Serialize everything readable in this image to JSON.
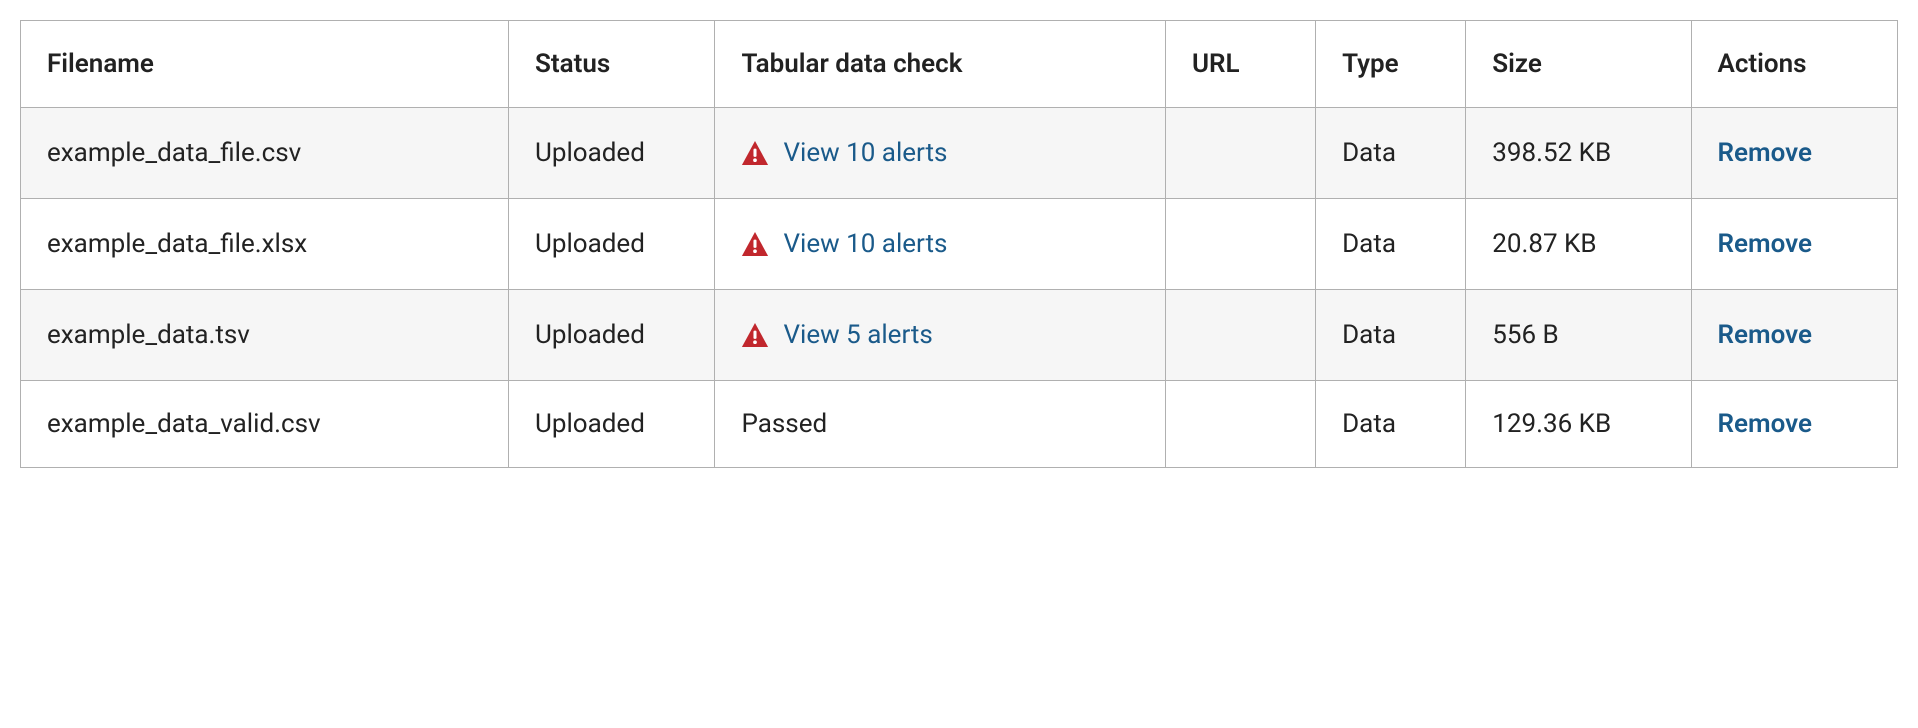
{
  "table": {
    "headers": {
      "filename": "Filename",
      "status": "Status",
      "check": "Tabular data check",
      "url": "URL",
      "type": "Type",
      "size": "Size",
      "actions": "Actions"
    },
    "rows": [
      {
        "filename": "example_data_file.csv",
        "status": "Uploaded",
        "check_passed": false,
        "check_text": "View 10 alerts",
        "url": "",
        "type": "Data",
        "size": "398.52 KB",
        "action": "Remove"
      },
      {
        "filename": "example_data_file.xlsx",
        "status": "Uploaded",
        "check_passed": false,
        "check_text": "View 10 alerts",
        "url": "",
        "type": "Data",
        "size": "20.87 KB",
        "action": "Remove"
      },
      {
        "filename": "example_data.tsv",
        "status": "Uploaded",
        "check_passed": false,
        "check_text": "View 5 alerts",
        "url": "",
        "type": "Data",
        "size": "556 B",
        "action": "Remove"
      },
      {
        "filename": "example_data_valid.csv",
        "status": "Uploaded",
        "check_passed": true,
        "check_text": "Passed",
        "url": "",
        "type": "Data",
        "size": "129.36 KB",
        "action": "Remove"
      }
    ]
  },
  "colors": {
    "alert_red": "#c1272d",
    "link_blue": "#1a5a8a"
  }
}
